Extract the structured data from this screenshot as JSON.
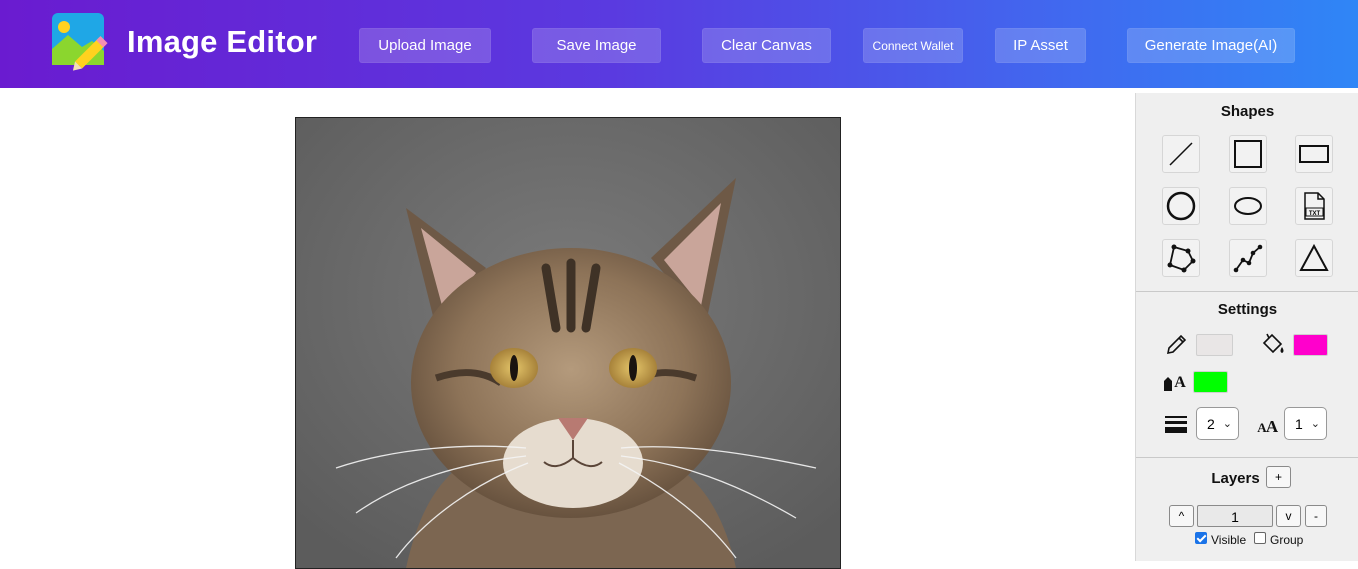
{
  "app": {
    "title": "Image Editor"
  },
  "toolbar": {
    "upload_label": "Upload Image",
    "save_label": "Save Image",
    "clear_label": "Clear Canvas",
    "wallet_label": "Connect Wallet",
    "ip_label": "IP Asset",
    "generate_label": "Generate Image(AI)"
  },
  "shapes": {
    "title": "Shapes",
    "items": [
      "line",
      "square",
      "rectangle",
      "circle",
      "ellipse",
      "text",
      "polygon",
      "polyline",
      "triangle"
    ]
  },
  "settings": {
    "title": "Settings",
    "stroke_color": "#e9e6e6",
    "fill_color": "#ff00cc",
    "text_color": "#00ff00",
    "line_width": "2",
    "font_size": "1"
  },
  "layers": {
    "title": "Layers",
    "add_label": "+",
    "up_label": "^",
    "down_label": "v",
    "remove_label": "-",
    "current_layer": "1",
    "visible_label": "Visible",
    "visible_checked": true,
    "group_label": "Group",
    "group_checked": false
  },
  "colors": {
    "header_start": "#6a1bd0",
    "header_end": "#2f86f6"
  }
}
